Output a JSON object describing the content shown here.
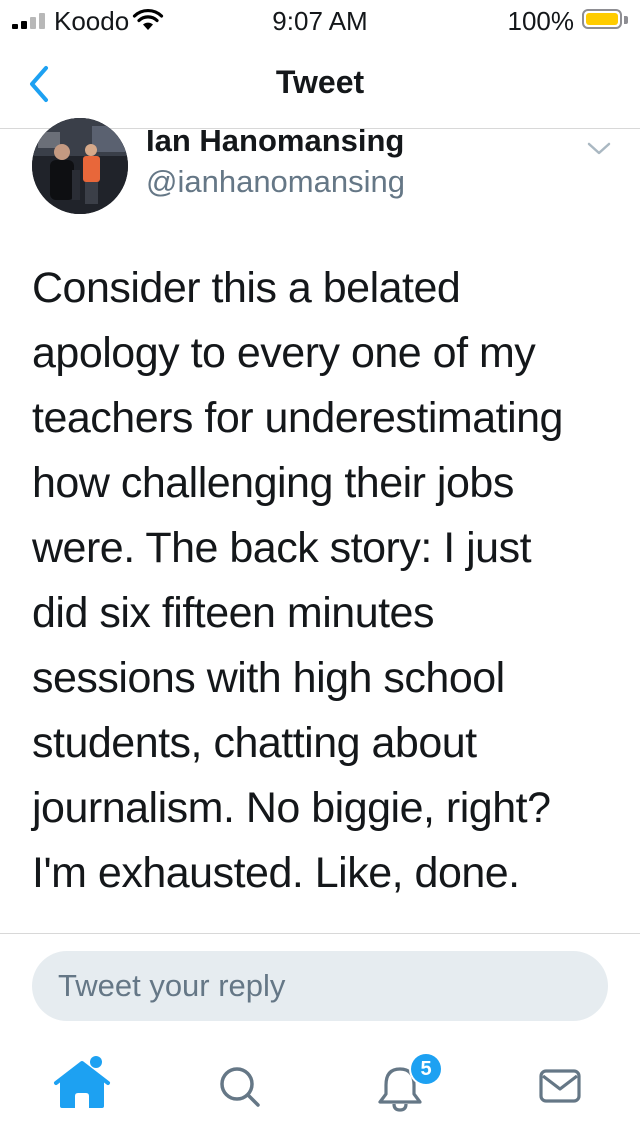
{
  "status_bar": {
    "carrier": "Koodo",
    "time": "9:07 AM",
    "battery_percent": "100%",
    "battery_level": 1.0,
    "signal_bars_filled": 2,
    "signal_bars_total": 4
  },
  "nav": {
    "title": "Tweet",
    "back_icon": "chevron-left-icon"
  },
  "tweet": {
    "author_name": "Ian Hanomansing",
    "author_handle": "@ianhanomansing",
    "text_lines": [
      "Consider this a belated",
      "apology to every one of my",
      "teachers for underestimating",
      "how challenging their jobs",
      "were. The back story: I just",
      "did six fifteen minutes",
      "sessions with high school",
      "students, chatting about",
      "journalism. No biggie, right?",
      "I'm exhausted. Like, done."
    ],
    "more_icon": "chevron-down-icon"
  },
  "reply": {
    "placeholder": "Tweet your reply"
  },
  "tab_bar": {
    "tabs": [
      {
        "name": "home",
        "icon": "home-icon",
        "active": true,
        "has_dot": true
      },
      {
        "name": "search",
        "icon": "search-icon",
        "active": false
      },
      {
        "name": "notifications",
        "icon": "bell-icon",
        "active": false,
        "badge": "5"
      },
      {
        "name": "messages",
        "icon": "mail-icon",
        "active": false
      }
    ]
  },
  "colors": {
    "accent": "#1da1f2",
    "icon_gray": "#657786",
    "text": "#14171a",
    "reply_bg": "#e6ecf0",
    "battery": "#ffcc00"
  }
}
